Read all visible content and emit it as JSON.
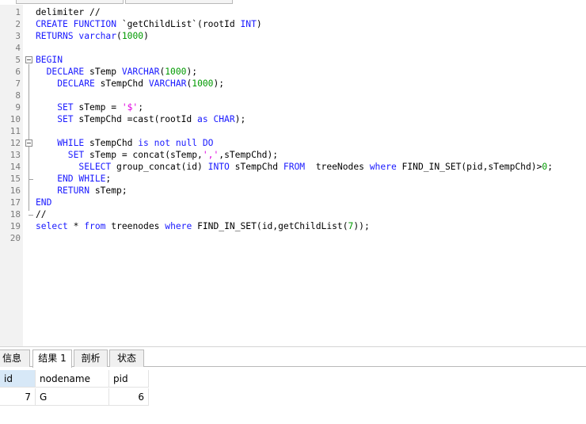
{
  "editor": {
    "lines": [
      {
        "n": "1",
        "tokens": [
          {
            "t": "delimiter //",
            "c": ""
          }
        ]
      },
      {
        "n": "2",
        "tokens": [
          {
            "t": "CREATE FUNCTION",
            "c": "kw"
          },
          {
            "t": " `getChildList`(rootId ",
            "c": ""
          },
          {
            "t": "INT",
            "c": "kw"
          },
          {
            "t": ")",
            "c": ""
          }
        ]
      },
      {
        "n": "3",
        "tokens": [
          {
            "t": "RETURNS varchar",
            "c": "kw"
          },
          {
            "t": "(",
            "c": ""
          },
          {
            "t": "1000",
            "c": "num"
          },
          {
            "t": ")",
            "c": ""
          }
        ]
      },
      {
        "n": "4",
        "tokens": []
      },
      {
        "n": "5",
        "tokens": [
          {
            "t": "BEGIN",
            "c": "kw"
          }
        ]
      },
      {
        "n": "6",
        "tokens": [
          {
            "t": "  DECLARE",
            "c": "kw"
          },
          {
            "t": " sTemp ",
            "c": ""
          },
          {
            "t": "VARCHAR",
            "c": "kw"
          },
          {
            "t": "(",
            "c": ""
          },
          {
            "t": "1000",
            "c": "num"
          },
          {
            "t": ");",
            "c": ""
          }
        ]
      },
      {
        "n": "7",
        "tokens": [
          {
            "t": "    DECLARE",
            "c": "kw"
          },
          {
            "t": " sTempChd ",
            "c": ""
          },
          {
            "t": "VARCHAR",
            "c": "kw"
          },
          {
            "t": "(",
            "c": ""
          },
          {
            "t": "1000",
            "c": "num"
          },
          {
            "t": ");",
            "c": ""
          }
        ]
      },
      {
        "n": "8",
        "tokens": []
      },
      {
        "n": "9",
        "tokens": [
          {
            "t": "    SET",
            "c": "kw"
          },
          {
            "t": " sTemp = ",
            "c": ""
          },
          {
            "t": "'$'",
            "c": "str"
          },
          {
            "t": ";",
            "c": ""
          }
        ]
      },
      {
        "n": "10",
        "tokens": [
          {
            "t": "    SET",
            "c": "kw"
          },
          {
            "t": " sTempChd =cast(rootId ",
            "c": ""
          },
          {
            "t": "as CHAR",
            "c": "kw"
          },
          {
            "t": ");",
            "c": ""
          }
        ]
      },
      {
        "n": "11",
        "tokens": []
      },
      {
        "n": "12",
        "tokens": [
          {
            "t": "    WHILE",
            "c": "kw"
          },
          {
            "t": " sTempChd ",
            "c": ""
          },
          {
            "t": "is not null DO",
            "c": "kw"
          }
        ]
      },
      {
        "n": "13",
        "tokens": [
          {
            "t": "      SET",
            "c": "kw"
          },
          {
            "t": " sTemp = concat(sTemp,",
            "c": ""
          },
          {
            "t": "','",
            "c": "str"
          },
          {
            "t": ",sTempChd);",
            "c": ""
          }
        ]
      },
      {
        "n": "14",
        "tokens": [
          {
            "t": "        SELECT",
            "c": "kw"
          },
          {
            "t": " group_concat(id) ",
            "c": ""
          },
          {
            "t": "INTO",
            "c": "kw"
          },
          {
            "t": " sTempChd ",
            "c": ""
          },
          {
            "t": "FROM",
            "c": "kw"
          },
          {
            "t": "  treeNodes ",
            "c": ""
          },
          {
            "t": "where",
            "c": "kw"
          },
          {
            "t": " FIND_IN_SET(pid,sTempChd)>",
            "c": ""
          },
          {
            "t": "0",
            "c": "num"
          },
          {
            "t": ";",
            "c": ""
          }
        ]
      },
      {
        "n": "15",
        "tokens": [
          {
            "t": "    END WHILE",
            "c": "kw"
          },
          {
            "t": ";",
            "c": ""
          }
        ]
      },
      {
        "n": "16",
        "tokens": [
          {
            "t": "    RETURN",
            "c": "kw"
          },
          {
            "t": " sTemp;",
            "c": ""
          }
        ]
      },
      {
        "n": "17",
        "tokens": [
          {
            "t": "END",
            "c": "kw"
          }
        ]
      },
      {
        "n": "18",
        "tokens": [
          {
            "t": "//",
            "c": ""
          }
        ]
      },
      {
        "n": "19",
        "tokens": [
          {
            "t": "select",
            "c": "kw"
          },
          {
            "t": " * ",
            "c": ""
          },
          {
            "t": "from",
            "c": "kw"
          },
          {
            "t": " treenodes ",
            "c": ""
          },
          {
            "t": "where",
            "c": "kw"
          },
          {
            "t": " FIND_IN_SET(id,getChildList(",
            "c": ""
          },
          {
            "t": "7",
            "c": "num"
          },
          {
            "t": "));",
            "c": ""
          }
        ]
      },
      {
        "n": "20",
        "tokens": []
      }
    ]
  },
  "result_tabs": {
    "info": "信息",
    "result": "结果 1",
    "profile": "剖析",
    "status": "状态"
  },
  "result_grid": {
    "columns": [
      "id",
      "nodename",
      "pid"
    ],
    "rows": [
      {
        "id": "7",
        "nodename": "G",
        "pid": "6"
      }
    ]
  }
}
